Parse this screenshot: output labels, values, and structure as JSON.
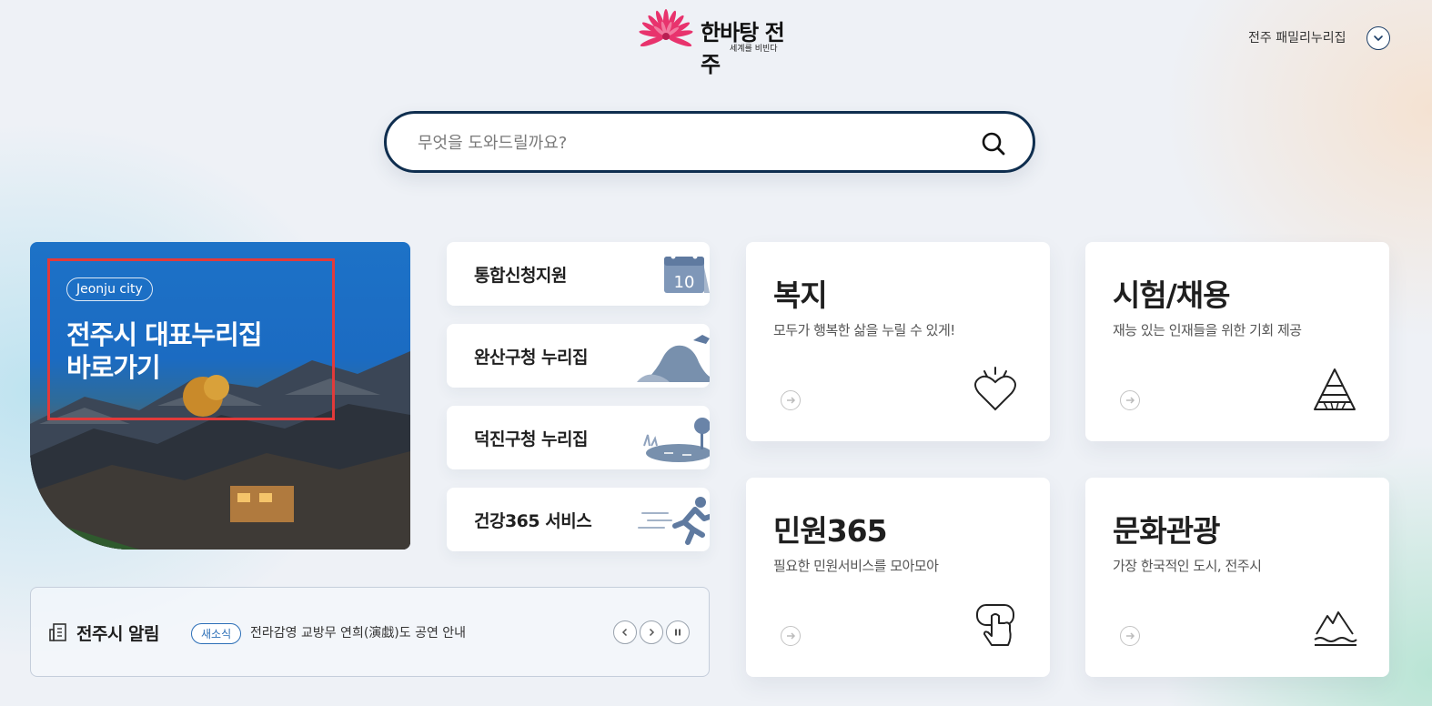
{
  "header": {
    "logo_text": "한바탕 전주",
    "logo_tagline": "세계를 비빈다",
    "family_link": "전주 패밀리누리집"
  },
  "search": {
    "placeholder": "무엇을 도와드릴까요?",
    "value": ""
  },
  "banner": {
    "badge": "Jeonju city",
    "title_line1": "전주시 대표누리집",
    "title_line2": "바로가기"
  },
  "quick_links": [
    {
      "label": "통합신청지원",
      "icon": "calendar-icon",
      "icon_text": "10"
    },
    {
      "label": "완산구청 누리집",
      "icon": "mountain-icon"
    },
    {
      "label": "덕진구청 누리집",
      "icon": "lake-tree-icon"
    },
    {
      "label": "건강365 서비스",
      "icon": "runner-icon"
    }
  ],
  "notice": {
    "title": "전주시 알림",
    "tag": "새소식",
    "text": "전라감영 교방무 연희(演戱)도 공연 안내"
  },
  "services": [
    {
      "title": "복지",
      "desc": "모두가 행복한 삶을 누릴 수 있게!",
      "icon": "heart-icon"
    },
    {
      "title": "시험/채용",
      "desc": "재능 있는 인재들을 위한 기회 제공",
      "icon": "pyramid-icon"
    },
    {
      "title": "민원365",
      "desc": "필요한 민원서비스를 모아모아",
      "icon": "hand-pointer-icon"
    },
    {
      "title": "문화관광",
      "desc": "가장 한국적인 도시, 전주시",
      "icon": "mountain-wave-icon"
    }
  ],
  "colors": {
    "accent_navy": "#0f2e4f",
    "banner_blue": "#1b6bc2",
    "highlight_red": "#e23a3a",
    "tag_blue": "#2c6fb7"
  }
}
